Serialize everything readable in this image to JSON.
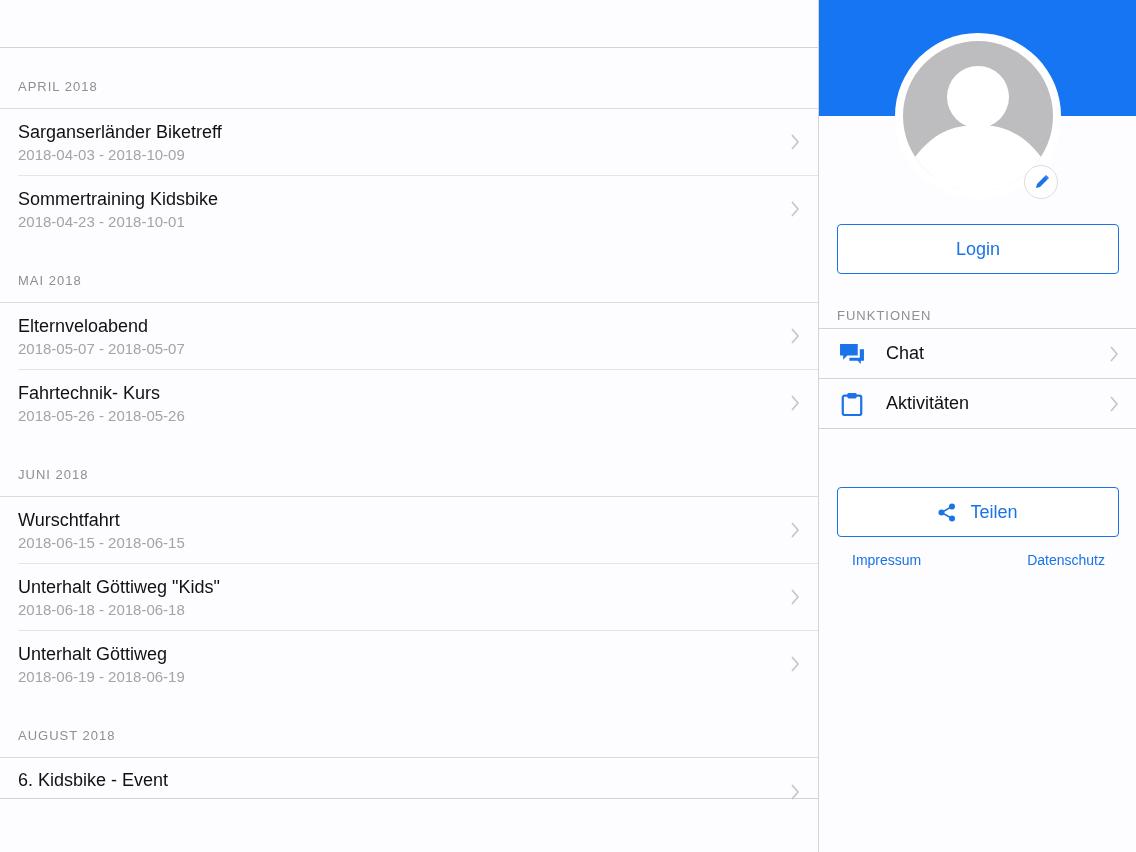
{
  "sections": [
    {
      "title": "APRIL 2018",
      "events": [
        {
          "name": "Sarganserländer Biketreff",
          "dates": "2018-04-03 - 2018-10-09"
        },
        {
          "name": "Sommertraining Kidsbike",
          "dates": "2018-04-23 - 2018-10-01"
        }
      ]
    },
    {
      "title": "MAI 2018",
      "events": [
        {
          "name": "Elternveloabend",
          "dates": "2018-05-07 - 2018-05-07"
        },
        {
          "name": "Fahrtechnik- Kurs",
          "dates": "2018-05-26 - 2018-05-26"
        }
      ]
    },
    {
      "title": "JUNI 2018",
      "events": [
        {
          "name": "Wurschtfahrt",
          "dates": "2018-06-15 - 2018-06-15"
        },
        {
          "name": "Unterhalt Göttiweg \"Kids\"",
          "dates": "2018-06-18 - 2018-06-18"
        },
        {
          "name": "Unterhalt Göttiweg",
          "dates": "2018-06-19 - 2018-06-19"
        }
      ]
    },
    {
      "title": "AUGUST 2018",
      "events": [
        {
          "name": "6. Kidsbike - Event"
        }
      ]
    }
  ],
  "profile": {
    "login_button": "Login"
  },
  "functions": {
    "title": "FUNKTIONEN",
    "items": [
      {
        "kind": "chat",
        "label": "Chat"
      },
      {
        "kind": "clipboard",
        "label": "Aktivitäten"
      }
    ]
  },
  "share_button": "Teilen",
  "links": [
    "Impressum",
    "Datenschutz"
  ]
}
